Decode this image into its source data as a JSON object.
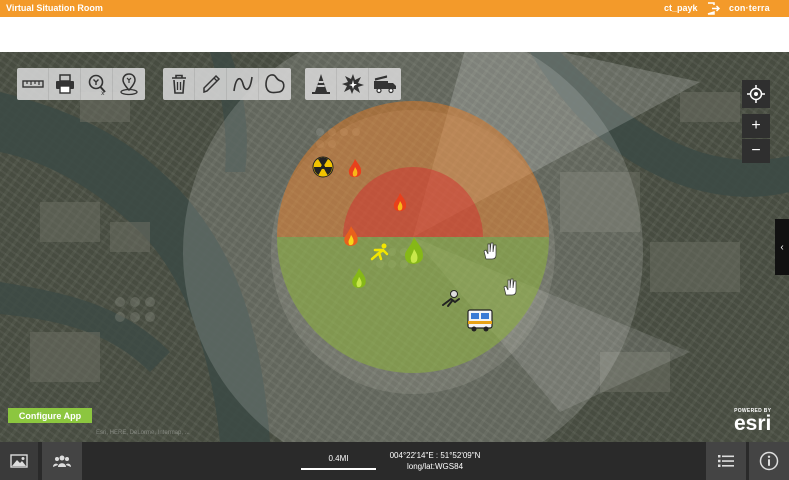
{
  "app": {
    "title": "Virtual Situation Room",
    "user": "ct_payk",
    "brand": "con·terra"
  },
  "toolbar": {
    "groups": [
      [
        "measure-icon",
        "print-icon",
        "select-by-polygon-icon",
        "select-by-point-icon"
      ],
      [
        "delete-icon",
        "draw-freehand-icon",
        "draw-line-icon",
        "draw-polygon-icon"
      ],
      [
        "roadblock-icon",
        "explosion-icon",
        "fire-truck-icon"
      ]
    ]
  },
  "map": {
    "configure_label": "Configure App",
    "attribution": "Esri, HERE, DeLorme, Intermap, ...",
    "powered_by": "POWERED BY",
    "esri_logo": "esri",
    "zoom_in": "+",
    "zoom_out": "−",
    "side_handle": "‹",
    "zones": [
      {
        "name": "hot",
        "color": "#d32f2f"
      },
      {
        "name": "warm",
        "color": "#ef7a1a"
      },
      {
        "name": "cold",
        "color": "#8db33a"
      },
      {
        "name": "plume",
        "color": "#ffffff"
      }
    ],
    "markers": [
      "radiation-icon",
      "fire-icon",
      "fire-icon",
      "fire-icon",
      "injured-person-icon",
      "fire-icon",
      "fire-icon",
      "hazard-hand-icon",
      "hazard-hand-icon",
      "rescue-icon",
      "ambulance-icon"
    ]
  },
  "statusbar": {
    "scale": "0.4MI",
    "coordinates": "004°22'14\"E : 51°52'09\"N",
    "projection": "long/lat:WGS84"
  }
}
